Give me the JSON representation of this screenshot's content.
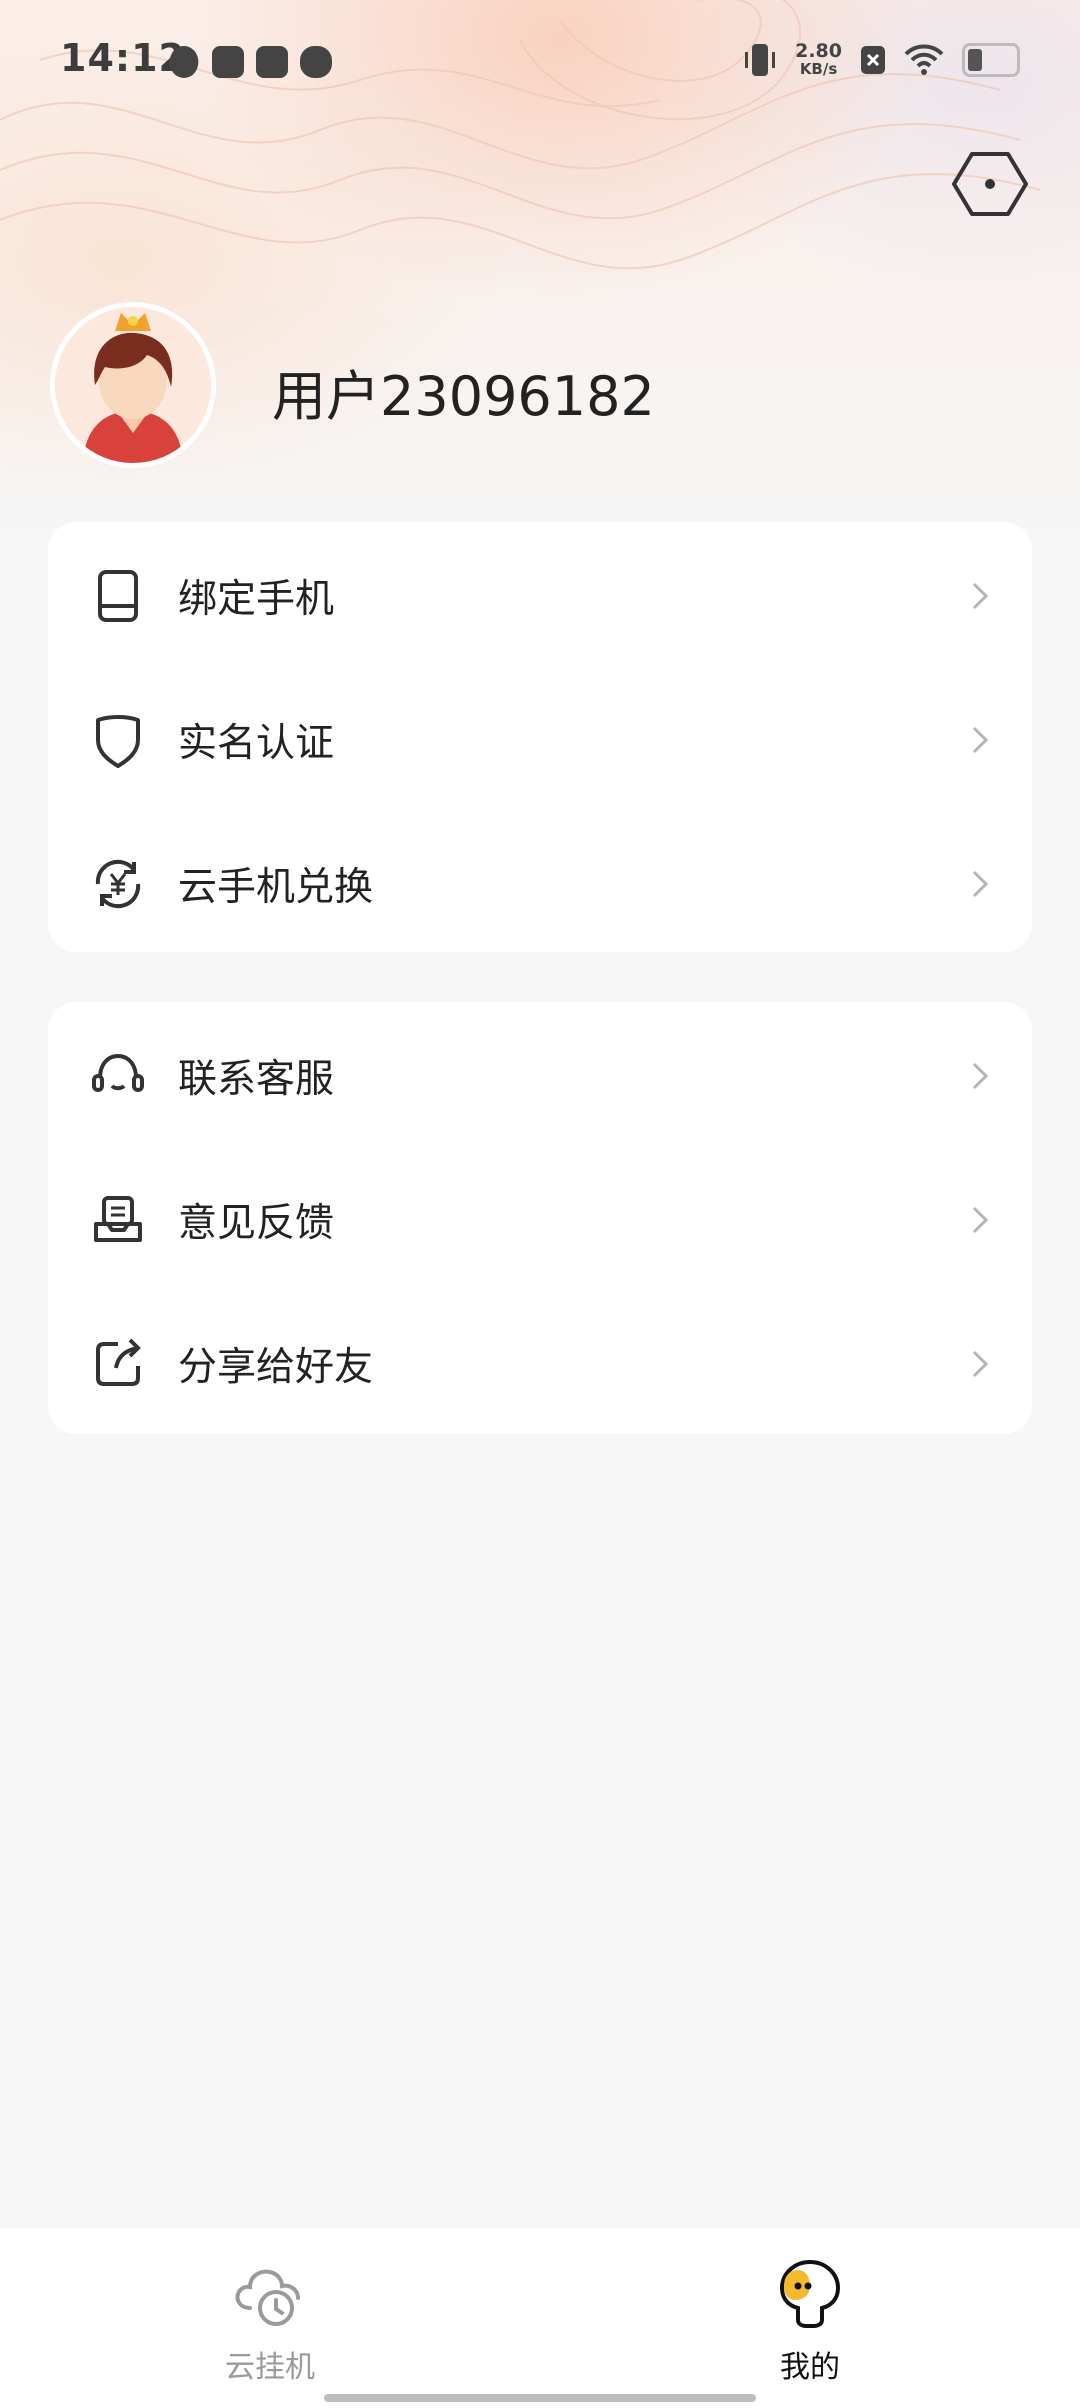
{
  "status_bar": {
    "time": "14:12",
    "net_speed_value": "2.80",
    "net_speed_unit": "KB/s",
    "notification_icons": [
      "app-notification-icon",
      "mail-icon",
      "calendar-icon",
      "cat-icon"
    ],
    "right_icons": [
      "vibrate-icon",
      "sim-off-icon",
      "wifi-icon",
      "battery-icon"
    ]
  },
  "header": {
    "settings_icon": "hexagon-settings-icon"
  },
  "profile": {
    "username": "用户23096182"
  },
  "menu_group_1": [
    {
      "label": "绑定手机",
      "icon": "phone-bind-icon"
    },
    {
      "label": "实名认证",
      "icon": "shield-icon"
    },
    {
      "label": "云手机兑换",
      "icon": "exchange-yuan-icon"
    }
  ],
  "menu_group_2": [
    {
      "label": "联系客服",
      "icon": "headset-icon"
    },
    {
      "label": "意见反馈",
      "icon": "feedback-icon"
    },
    {
      "label": "分享给好友",
      "icon": "share-icon"
    }
  ],
  "tabbar": {
    "tabs": [
      {
        "label": "云挂机",
        "icon": "cloud-clock-icon",
        "active": false
      },
      {
        "label": "我的",
        "icon": "mascot-icon",
        "active": true
      }
    ]
  },
  "colors": {
    "background": "#f6f6f6",
    "card": "#ffffff",
    "text_primary": "#222222",
    "tab_inactive": "#9a9a9a",
    "accent_yellow": "#f5b92e"
  }
}
